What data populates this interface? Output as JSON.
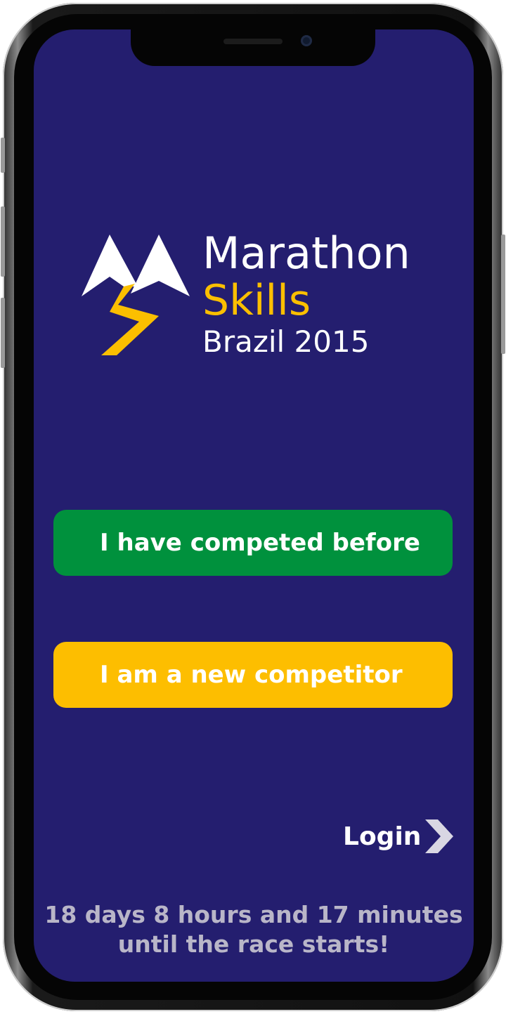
{
  "logo": {
    "line1": "Marathon",
    "line2": "Skills",
    "line3": "Brazil 2015"
  },
  "actions": {
    "competed_before_label": "I have competed before",
    "new_competitor_label": "I am a new competitor",
    "login_label": "Login"
  },
  "countdown": {
    "line1": "18 days 8 hours and 17 minutes",
    "line2": "until the race starts!"
  },
  "colors": {
    "background": "#241e6f",
    "green_button": "#00913d",
    "yellow_button": "#fdbe00",
    "accent_yellow": "#fbbf00",
    "countdown_text": "#b9b6c8"
  },
  "icons": {
    "logo_mark": "mountain-peaks-lightning-icon",
    "login_arrow": "chevron-right-icon"
  }
}
